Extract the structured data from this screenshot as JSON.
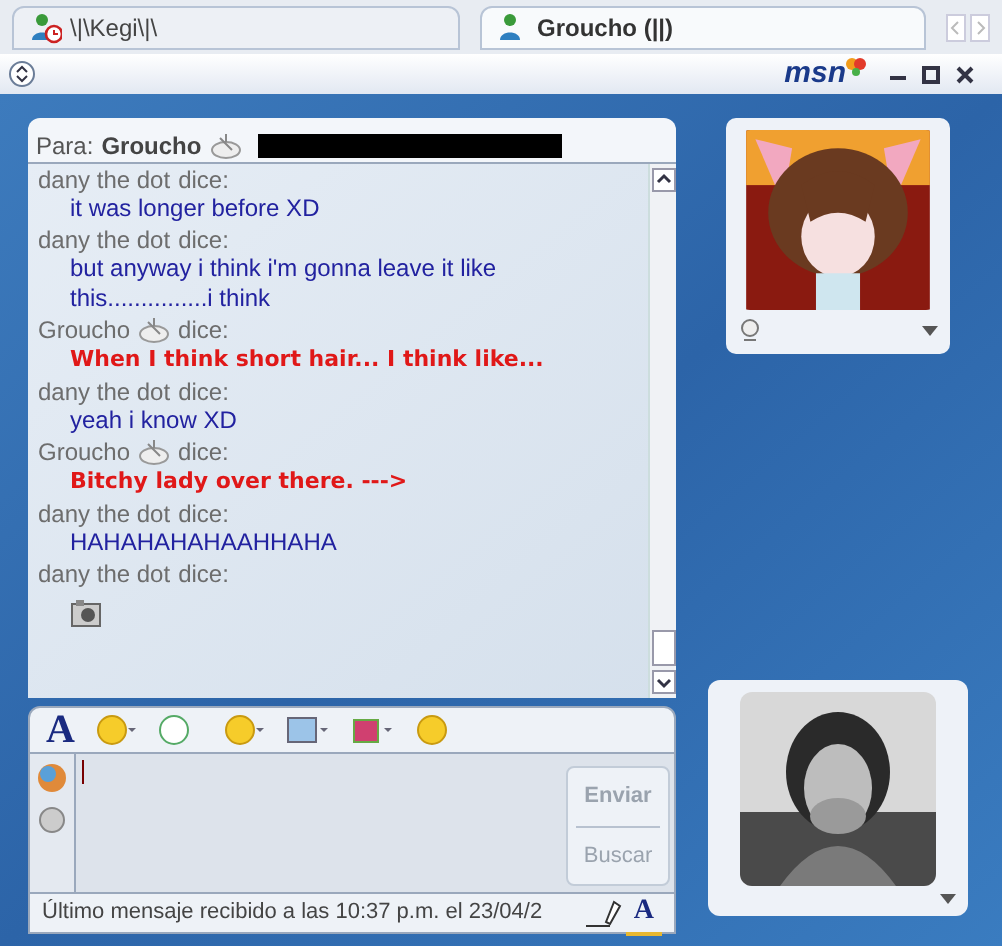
{
  "tabs": [
    {
      "label": "\\|\\Kegi\\|\\",
      "selected": false,
      "kind": "away"
    },
    {
      "label": "Groucho (||)",
      "selected": true,
      "kind": "online"
    }
  ],
  "font_button": "A",
  "text_mode_button": "A",
  "header": {
    "to_label": "Para:",
    "contact": "Groucho"
  },
  "messages": [
    {
      "name": "dany the dot",
      "verb": "dice:",
      "icon": false,
      "kind": "text",
      "text": "it was longer before XD"
    },
    {
      "name": "dany the dot",
      "verb": "dice:",
      "icon": false,
      "kind": "text",
      "text": "but anyway i think i'm gonna leave it like this...............i think"
    },
    {
      "name": "Groucho",
      "verb": "dice:",
      "icon": true,
      "kind": "emphasis",
      "text": "When I think short hair... I think like..."
    },
    {
      "name": "dany the dot",
      "verb": "dice:",
      "icon": false,
      "kind": "text",
      "text": "yeah i know XD"
    },
    {
      "name": "Groucho",
      "verb": "dice:",
      "icon": true,
      "kind": "emphasis",
      "text": "Bitchy lady over there. --->"
    },
    {
      "name": "dany the dot",
      "verb": "dice:",
      "icon": false,
      "kind": "text",
      "text": "HAHAHAHAHAAHHAHA"
    },
    {
      "name": "dany the dot",
      "verb": "dice:",
      "icon": false
    }
  ],
  "input": {
    "send": "Enviar",
    "search": "Buscar",
    "disabled": true
  },
  "status_bar": "Último mensaje recibido a las 10:37 p.m. el 23/04/2",
  "logo": "msn"
}
